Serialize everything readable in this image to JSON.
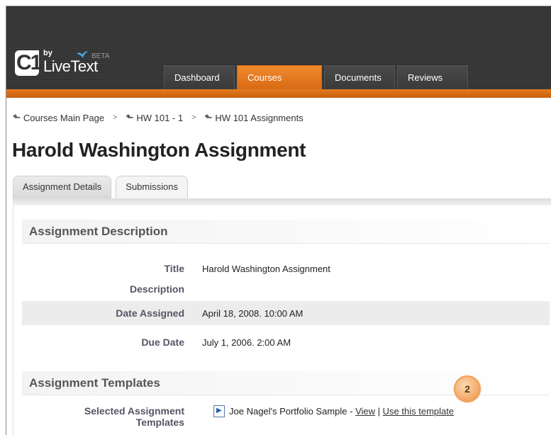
{
  "logo": {
    "by": "by",
    "text": "LiveText",
    "beta": "BETA",
    "mark": "C1"
  },
  "nav": {
    "tabs": [
      "Dashboard",
      "Courses",
      "Documents",
      "Reviews"
    ],
    "active": "Courses"
  },
  "breadcrumb": {
    "items": [
      "Courses Main Page",
      "HW 101 - 1",
      "HW 101 Assignments"
    ],
    "separator": ">"
  },
  "page_title": "Harold Washington Assignment",
  "tabs": [
    "Assignment Details",
    "Submissions"
  ],
  "description_section": {
    "heading": "Assignment Description",
    "rows": [
      {
        "label": "Title",
        "value": "Harold Washington Assignment"
      },
      {
        "label": "Description",
        "value": ""
      },
      {
        "label": "Date Assigned",
        "value": "April 18, 2008. 10:00 AM"
      },
      {
        "label": "Due Date",
        "value": "July 1, 2006. 2:00 AM"
      }
    ]
  },
  "templates_section": {
    "heading": "Assignment Templates",
    "label_line1": "Selected Assignment",
    "label_line2": "Templates",
    "template_name": "Joe Nagel's Portfolio Sample -",
    "view_link": "View",
    "divider": "|",
    "use_link": "Use this template"
  },
  "callout_badge": "2",
  "colors": {
    "accent": "#e27a1f",
    "header_bg": "#383838"
  }
}
